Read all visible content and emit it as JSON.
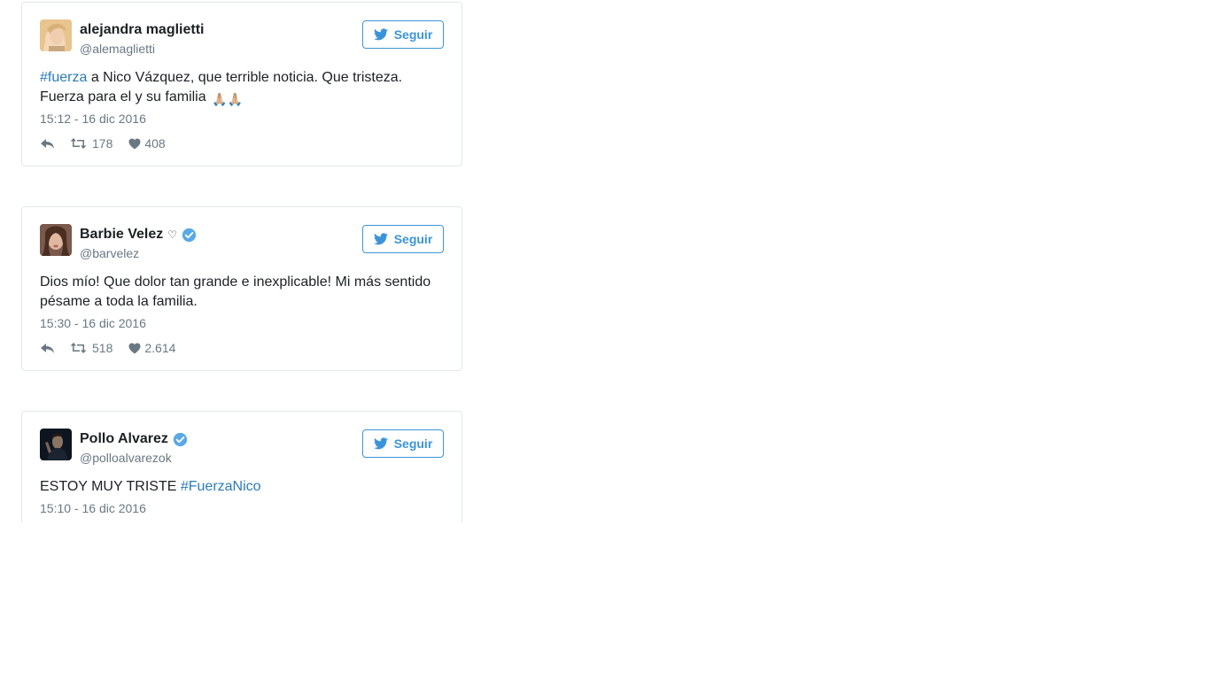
{
  "tweets": [
    {
      "name": "alejandra maglietti",
      "handle": "@alemaglietti",
      "follow_label": "Seguir",
      "text_parts": [
        {
          "hashtag": "#fuerza"
        },
        {
          "plain": " a Nico Vázquez, que terrible noticia. Que tristeza. Fuerza para el y su familia"
        },
        {
          "emoji": "🙏🏼🙏🏼"
        }
      ],
      "timestamp": "15:12 - 16 dic 2016",
      "retweets": "178",
      "likes": "408"
    },
    {
      "name": "Barbie Velez",
      "name_suffix": "♡",
      "verified": true,
      "handle": "@barvelez",
      "follow_label": "Seguir",
      "text": "Dios mío! Que dolor tan grande e inexplicable! Mi más sentido pésame a toda la familia.",
      "timestamp": "15:30 - 16 dic 2016",
      "retweets": "518",
      "likes": "2.614"
    },
    {
      "name": "Pollo Alvarez",
      "verified": true,
      "handle": "@polloalvarezok",
      "follow_label": "Seguir",
      "text_plain": "ESTOY MUY TRISTE ",
      "text_hashtag": "#FuerzaNico",
      "timestamp": "15:10 - 16 dic 2016"
    }
  ],
  "icons": {
    "bird": "twitter-bird-icon",
    "verified": "verified-badge-icon",
    "reply": "reply-icon",
    "retweet": "retweet-icon",
    "like": "heart-icon"
  },
  "colors": {
    "link": "#2b7bb9",
    "button": "#3b94d9",
    "muted": "#697882",
    "border": "#e1e8ed",
    "verified": "#1da1f2"
  }
}
